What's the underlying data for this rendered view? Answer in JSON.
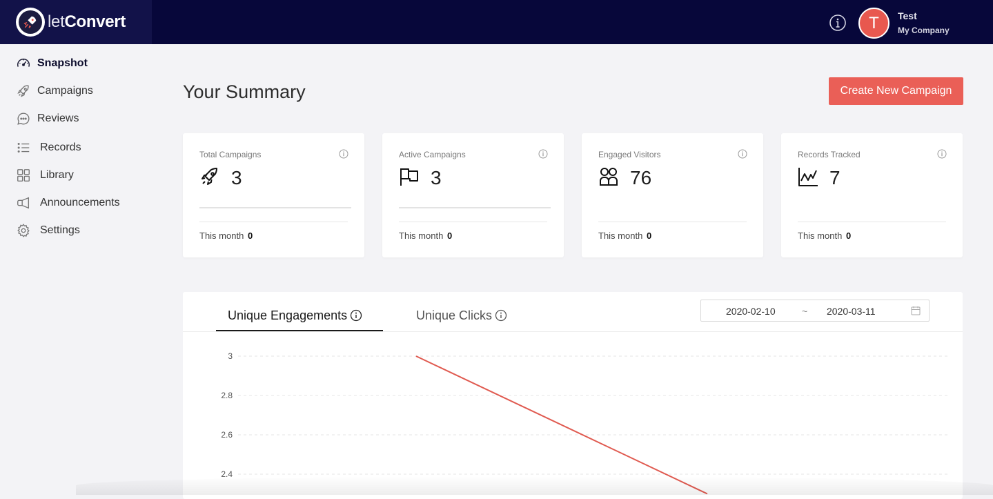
{
  "brand": {
    "name_light": "let",
    "name_bold": "Convert"
  },
  "user": {
    "initial": "T",
    "name": "Test",
    "company": "My Company"
  },
  "sidebar": {
    "items": [
      {
        "label": "Snapshot",
        "icon": "speedometer-icon"
      },
      {
        "label": "Campaigns",
        "icon": "rocket-icon"
      },
      {
        "label": "Reviews",
        "icon": "chat-icon"
      },
      {
        "label": "Records",
        "icon": "list-icon"
      },
      {
        "label": "Library",
        "icon": "grid-icon"
      },
      {
        "label": "Announcements",
        "icon": "megaphone-icon"
      },
      {
        "label": "Settings",
        "icon": "gear-icon"
      }
    ]
  },
  "main": {
    "title": "Your Summary",
    "create_button": "Create New Campaign"
  },
  "cards": [
    {
      "title": "Total Campaigns",
      "value": "3",
      "month_label": "This month",
      "month_value": "0",
      "icon": "rocket-icon"
    },
    {
      "title": "Active Campaigns",
      "value": "3",
      "month_label": "This month",
      "month_value": "0",
      "icon": "flag-icon"
    },
    {
      "title": "Engaged Visitors",
      "value": "76",
      "month_label": "This month",
      "month_value": "0",
      "icon": "people-icon"
    },
    {
      "title": "Records Tracked",
      "value": "7",
      "month_label": "This month",
      "month_value": "0",
      "icon": "line-chart-icon"
    }
  ],
  "chart_panel": {
    "tabs": [
      "Unique Engagements",
      "Unique Clicks"
    ],
    "active_tab": "Unique Engagements",
    "date_start": "2020-02-10",
    "date_separator": "~",
    "date_end": "2020-03-11"
  },
  "chart_data": {
    "type": "line",
    "yticks": [
      "3",
      "2.8",
      "2.6",
      "2.4"
    ],
    "series": [
      {
        "color": "#e05a50",
        "points": [
          [
            0,
            3
          ],
          [
            1,
            2.3
          ]
        ]
      }
    ],
    "ylim": [
      2.3,
      3
    ],
    "grid": true
  },
  "colors": {
    "accent": "#ea5f57",
    "topbar": "#07073a"
  }
}
